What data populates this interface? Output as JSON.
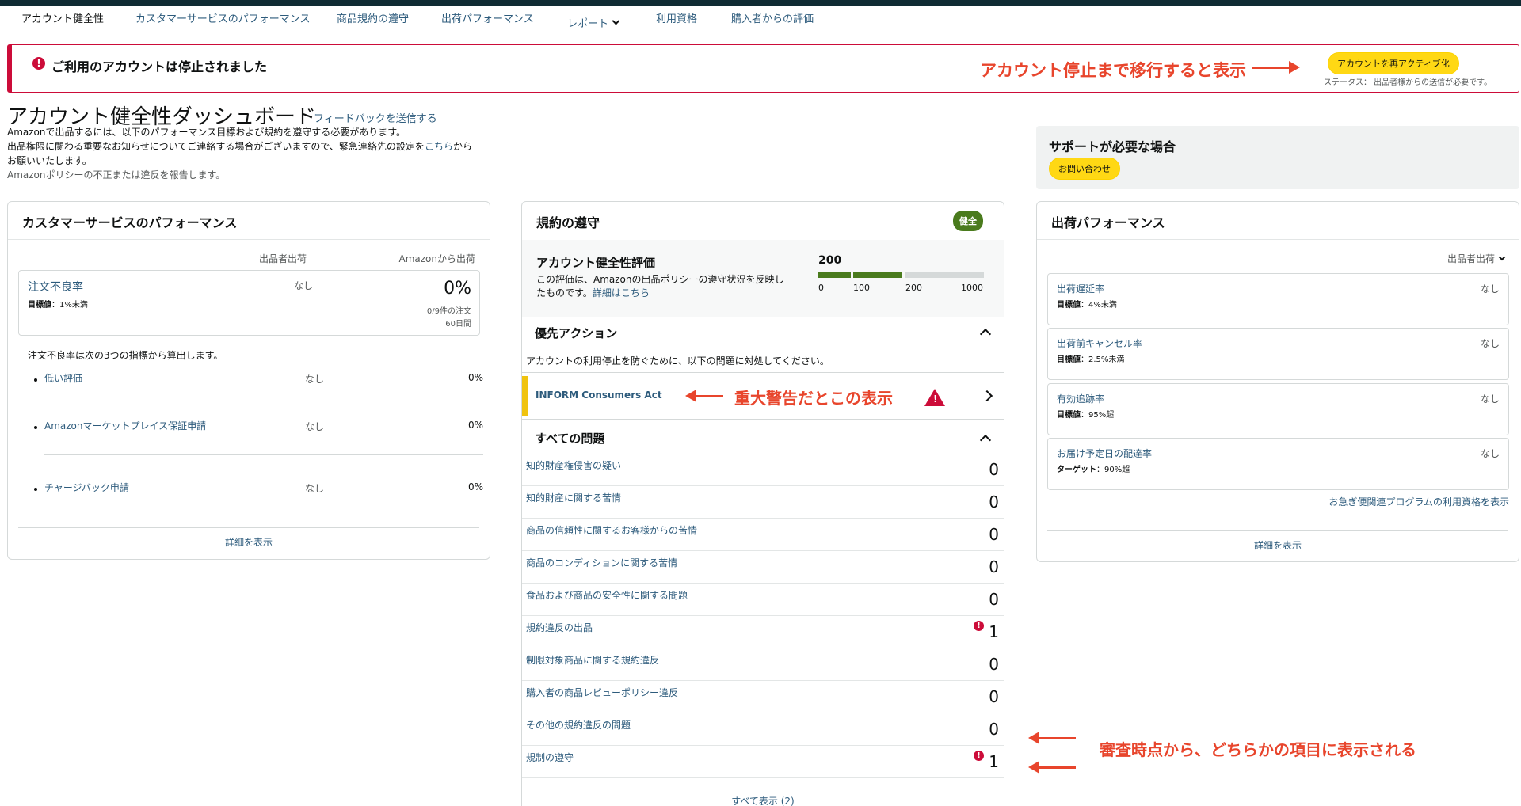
{
  "nav": {
    "items": [
      "アカウント健全性",
      "カスタマーサービスのパフォーマンス",
      "商品規約の遵守",
      "出荷パフォーマンス",
      "レポート",
      "利用資格",
      "購入者からの評価"
    ]
  },
  "banner": {
    "title": "ご利用のアカウントは停止されました",
    "annotation": "アカウント停止まで移行すると表示",
    "button": "アカウントを再アクティブ化",
    "status": "ステータス： 出品者様からの送信が必要です。"
  },
  "header": {
    "title": "アカウント健全性ダッシュボード",
    "feedback": "フィードバックを送信する",
    "line1": "Amazonで出品するには、以下のパフォーマンス目標および規約を遵守する必要があります。",
    "line2_pre": "出品権限に関わる重要なお知らせについてご連絡する場合がございますので、緊急連絡先の設定を",
    "line2_link": "こちら",
    "line2_post": "から",
    "line3": "お願いいたします。",
    "line4": "Amazonポリシーの不正または違反を報告します。"
  },
  "support": {
    "title": "サポートが必要な場合",
    "button": "お問い合わせ"
  },
  "cs": {
    "title": "カスタマーサービスのパフォーマンス",
    "col_seller": "出品者出荷",
    "col_amazon": "Amazonから出荷",
    "odr": {
      "name": "注文不良率",
      "target_label": "目標値",
      "target_value": "：1%未満",
      "seller": "なし",
      "pct": "0%",
      "sub1": "0/9件の注文",
      "sub2": "60日間"
    },
    "note": "注文不良率は次の3つの指標から算出します。",
    "subs": [
      {
        "label": "低い評価",
        "seller": "なし",
        "pct": "0%"
      },
      {
        "label": "Amazonマーケットプレイス保証申請",
        "seller": "なし",
        "pct": "0%"
      },
      {
        "label": "チャージバック申請",
        "seller": "なし",
        "pct": "0%"
      }
    ],
    "details": "詳細を表示"
  },
  "policy": {
    "title": "規約の遵守",
    "badge": "健全",
    "ahr": {
      "title": "アカウント健全性評価",
      "desc_pre": "この評価は、Amazonの出品ポリシーの遵守状況を反映したものです。",
      "desc_link": "詳細はこちら",
      "score": "200",
      "ticks": [
        "0",
        "100",
        "200",
        "1000"
      ],
      "score_value": 200,
      "colors": {
        "good": "#4a7b1d",
        "empty": "#d5d9d9"
      }
    },
    "priority": {
      "title": "優先アクション",
      "desc": "アカウントの利用停止を防ぐために、以下の問題に対処してください。",
      "item": "INFORM Consumers Act",
      "annotation": "重大警告だとこの表示"
    },
    "all_title": "すべての問題",
    "issues": [
      {
        "label": "知的財産権侵害の疑い",
        "value": "0"
      },
      {
        "label": "知的財産に関する苦情",
        "value": "0"
      },
      {
        "label": "商品の信頼性に関するお客様からの苦情",
        "value": "0"
      },
      {
        "label": "商品のコンディションに関する苦情",
        "value": "0"
      },
      {
        "label": "食品および商品の安全性に関する問題",
        "value": "0"
      },
      {
        "label": "規約違反の出品",
        "value": "1",
        "alert": true
      },
      {
        "label": "制限対象商品に関する規約違反",
        "value": "0"
      },
      {
        "label": "購入者の商品レビューポリシー違反",
        "value": "0"
      },
      {
        "label": "その他の規約違反の問題",
        "value": "0"
      },
      {
        "label": "規制の遵守",
        "value": "1",
        "alert": true
      }
    ],
    "show_all": "すべて表示 (2)",
    "bottom_annotation": "審査時点から、どちらかの項目に表示される"
  },
  "shipping": {
    "title": "出荷パフォーマンス",
    "filter": "出品者出荷",
    "metrics": [
      {
        "label": "出荷遅延率",
        "target_label": "目標値",
        "target_value": "：4%未満",
        "value": "なし"
      },
      {
        "label": "出荷前キャンセル率",
        "target_label": "目標値",
        "target_value": "：2.5%未満",
        "value": "なし"
      },
      {
        "label": "有効追跡率",
        "target_label": "目標値",
        "target_value": "：95%超",
        "value": "なし"
      },
      {
        "label": "お届け予定日の配達率",
        "target_label": "ターゲット",
        "target_value": "：90%超",
        "value": "なし"
      }
    ],
    "program_link": "お急ぎ便関連プログラムの利用資格を表示",
    "details": "詳細を表示"
  }
}
